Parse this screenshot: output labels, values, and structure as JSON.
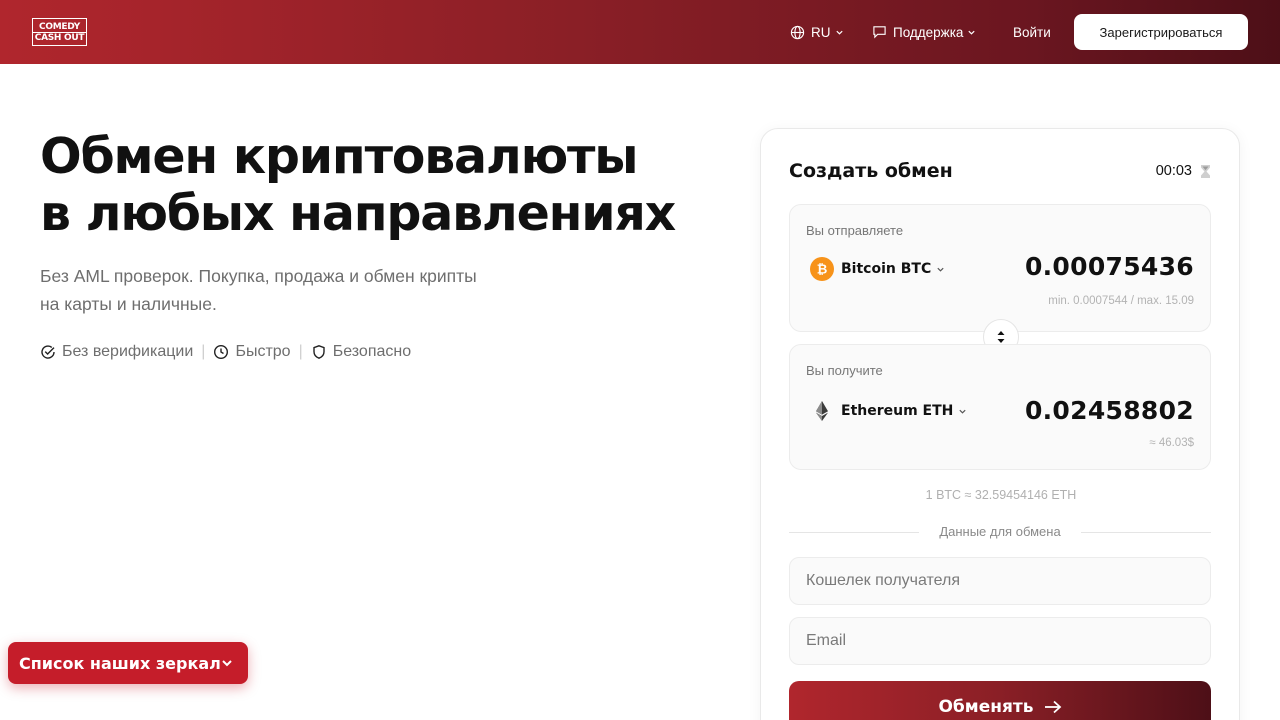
{
  "header": {
    "logo_line1": "COMEDY",
    "logo_line2": "CASH OUT",
    "language": "RU",
    "support_label": "Поддержка",
    "login_label": "Войти",
    "register_label": "Зарегистрироваться",
    "gradient_colors": [
      "#b0262d",
      "#4d0f17"
    ]
  },
  "hero": {
    "title_line1": "Обмен криптовалюты",
    "title_line2": "в любых направлениях",
    "subtitle": "Без AML проверок. Покупка, продажа и обмен крипты на карты и наличные.",
    "features": [
      {
        "icon": "check-circle-icon",
        "label": "Без верификации"
      },
      {
        "icon": "clock-icon",
        "label": "Быстро"
      },
      {
        "icon": "shield-icon",
        "label": "Безопасно"
      }
    ],
    "separator": "|"
  },
  "exchange": {
    "title": "Создать обмен",
    "timer": "00:03",
    "send": {
      "label": "Вы отправляете",
      "coin": "Bitcoin BTC",
      "coin_color": "#f7931a",
      "amount": "0.00075436",
      "limits": "min. 0.0007544 / max. 15.09"
    },
    "receive": {
      "label": "Вы получите",
      "coin": "Ethereum ETH",
      "amount": "0.02458802",
      "usd_estimate": "≈ 46.03$"
    },
    "rate": "1 BTC ≈ 32.59454146 ETH",
    "section_label": "Данные для обмена",
    "wallet_placeholder": "Кошелек получателя",
    "email_placeholder": "Email",
    "submit_label": "Обменять"
  },
  "mirror_button": {
    "label": "Список наших зеркал"
  },
  "colors": {
    "accent": "#c51d2a",
    "text": "#111111",
    "muted": "#6e6e6e"
  }
}
